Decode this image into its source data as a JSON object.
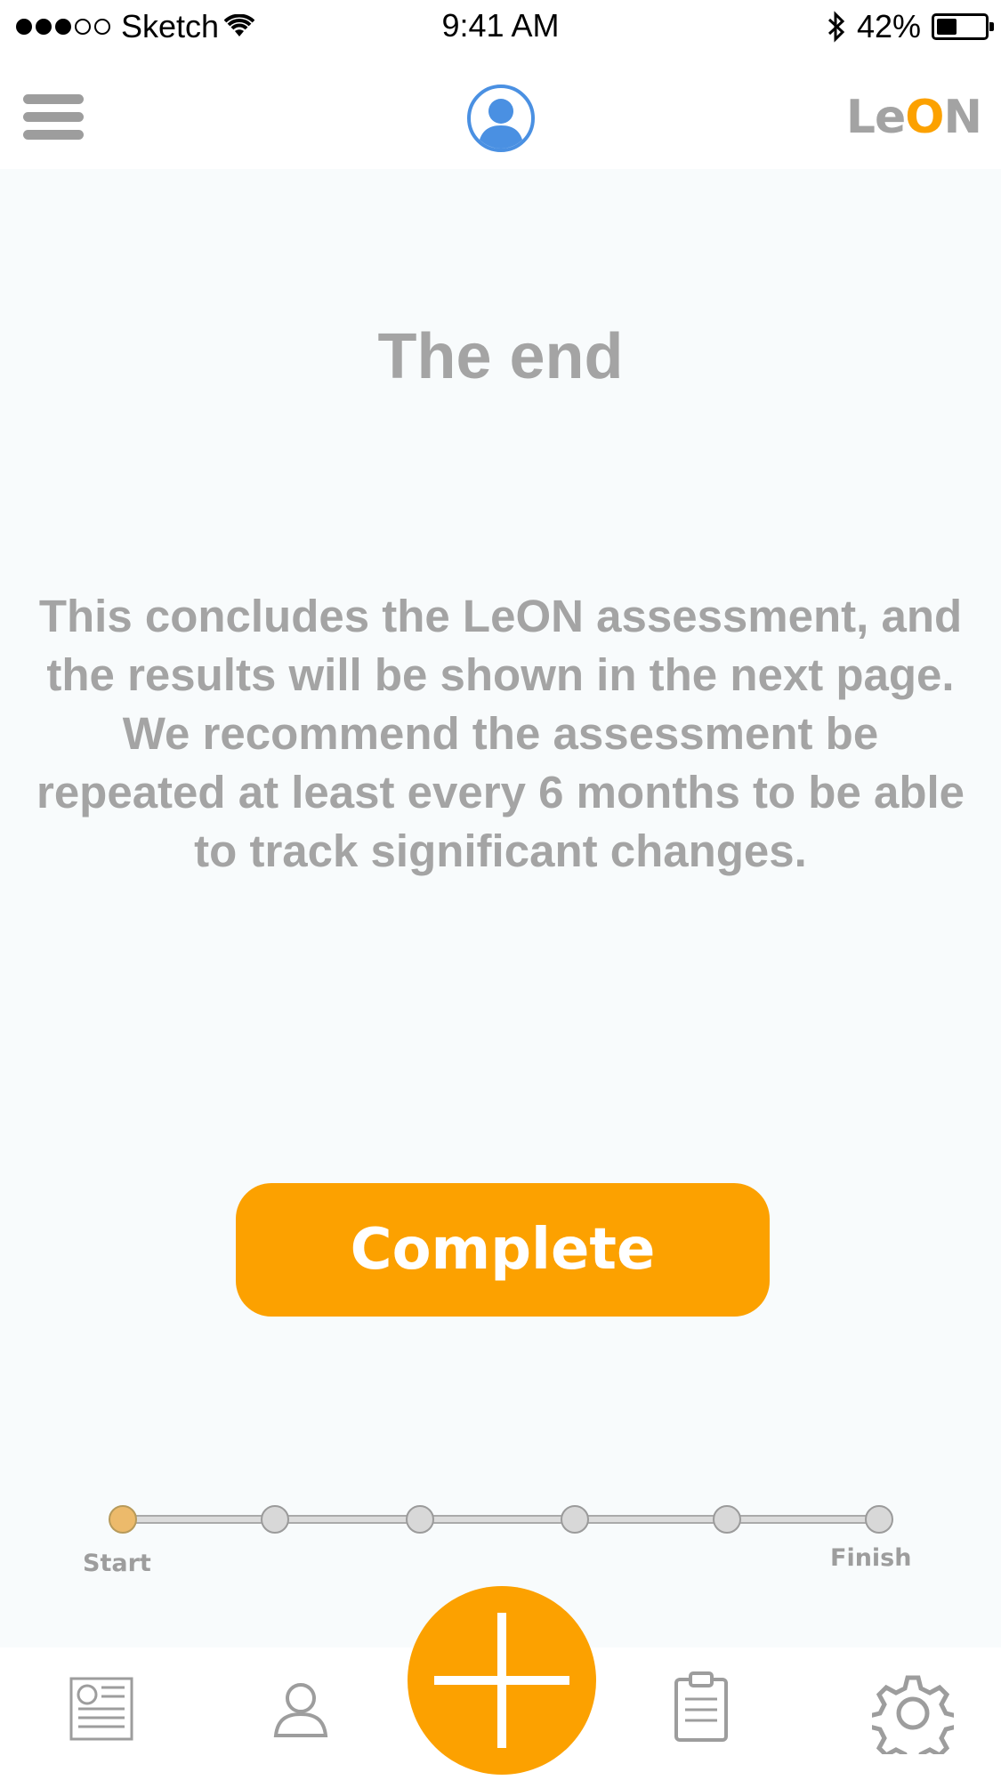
{
  "status_bar": {
    "carrier": "Sketch",
    "time": "9:41 AM",
    "battery": "42%",
    "battery_level": 0.42,
    "signal_icon": "signal-dots-icon",
    "wifi_icon": "wifi-icon",
    "bluetooth_icon": "bluetooth-icon"
  },
  "nav": {
    "menu_icon": "hamburger-menu-icon",
    "profile_icon": "user-avatar-icon",
    "logo_prefix": "Le",
    "logo_o": "O",
    "logo_suffix": "N"
  },
  "main": {
    "title": "The end",
    "message": "This concludes the LeON assessment, and the results will be shown in the next page. We recommend the assessment be repeated at least every 6 months to be able to track significant changes.",
    "complete_label": "Complete"
  },
  "progress": {
    "start_label": "Start",
    "finish_label": "Finish",
    "total_steps": 6,
    "current_step": 1
  },
  "tab_bar": {
    "items": [
      {
        "icon": "news-icon"
      },
      {
        "icon": "profile-icon"
      },
      {
        "icon": "add-icon"
      },
      {
        "icon": "clipboard-icon"
      },
      {
        "icon": "gear-icon"
      }
    ]
  },
  "colors": {
    "accent": "#fca100",
    "text_gray": "#a4a4a4",
    "avatar_blue": "#4a90e2",
    "background": "#f8fbfc"
  }
}
